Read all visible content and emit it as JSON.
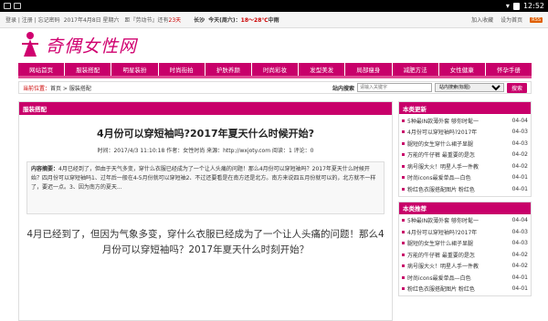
{
  "status": {
    "time": "12:52"
  },
  "topbar": {
    "links": "登录 | 注册 | 忘记密码",
    "date": "2017年4月8日 星期六",
    "holiday_prefix": "距『劳动节』还有",
    "holiday_days": "23天",
    "city": "长沙",
    "weather_label": "今天(周六)：",
    "temp": "18～28℃",
    "wind": "中雨",
    "fav": "加入收藏",
    "home": "设为首页",
    "rss": "RSS"
  },
  "site": {
    "name": "奇偶女性网"
  },
  "nav": [
    "网站首页",
    "服装搭配",
    "明星装扮",
    "时尚街拍",
    "护肤养颜",
    "时尚彩妆",
    "发型美发",
    "局部瘦身",
    "减肥方法",
    "女性健康",
    "怀孕手册"
  ],
  "crumb": {
    "label": "当前位置：",
    "path": "首页 > 服装搭配"
  },
  "search": {
    "title": "站内搜索",
    "placeholder": "请输入关键字",
    "option": "站内搜索(标题)",
    "button": "搜索"
  },
  "article": {
    "section": "服装搭配",
    "title": "4月份可以穿短袖吗?2017年夏天什么时候开始?",
    "meta": "时间：2017/4/3 11:10:18   作者：女性时尚   来源：http://wxjoty.com   阅读：1   评论：0",
    "summary_label": "内容摘要：",
    "summary": "4月已经到了，但由于天气多变，穿什么衣服已经成为了一个让人头痛的问题！那么4月份可以穿短袖吗？2017年夏天什么时候开始？四月份可以穿短袖吗1、过年后一般在4-5月份就可以穿短袖2、不过还要看是在南方还是北方。南方来说四五月份就可以的，北方就不一样了，要迟一点。3、因为南方的夏天...",
    "body": "4月已经到了，但因为气象多变，穿什么衣服已经成为了一个让人头痛的问题！那么4月份可以穿短袖吗？2017年夏天什么时刻开始？"
  },
  "sidebar": {
    "latest": {
      "title": "本类更新",
      "items": [
        {
          "t": "5种最IN款薄外套 够你时髦一",
          "d": "04-04"
        },
        {
          "t": "4月份可以穿短袖吗?2017年",
          "d": "04-03"
        },
        {
          "t": "腿短的女生穿什么裙子显腿",
          "d": "04-03"
        },
        {
          "t": "万能的牛仔裤 最重要的是怎",
          "d": "04-02"
        },
        {
          "t": "病号服大火！明星人手一件教",
          "d": "04-02"
        },
        {
          "t": "时尚icons最爱单品—白色",
          "d": "04-01"
        },
        {
          "t": "粉红色衣服搭配图片 粉红色",
          "d": "04-01"
        }
      ]
    },
    "recommend": {
      "title": "本类推荐",
      "items": [
        {
          "t": "5种最IN款薄外套 够你时髦一",
          "d": "04-04"
        },
        {
          "t": "4月份可以穿短袖吗?2017年",
          "d": "04-03"
        },
        {
          "t": "腿短的女生穿什么裙子显腿",
          "d": "04-03"
        },
        {
          "t": "万能的牛仔裤 最重要的是怎",
          "d": "04-02"
        },
        {
          "t": "病号服大火！明星人手一件教",
          "d": "04-02"
        },
        {
          "t": "时尚icons最爱单品—白色",
          "d": "04-01"
        },
        {
          "t": "粉红色衣服搭配图片 粉红色",
          "d": "04-01"
        }
      ]
    }
  }
}
